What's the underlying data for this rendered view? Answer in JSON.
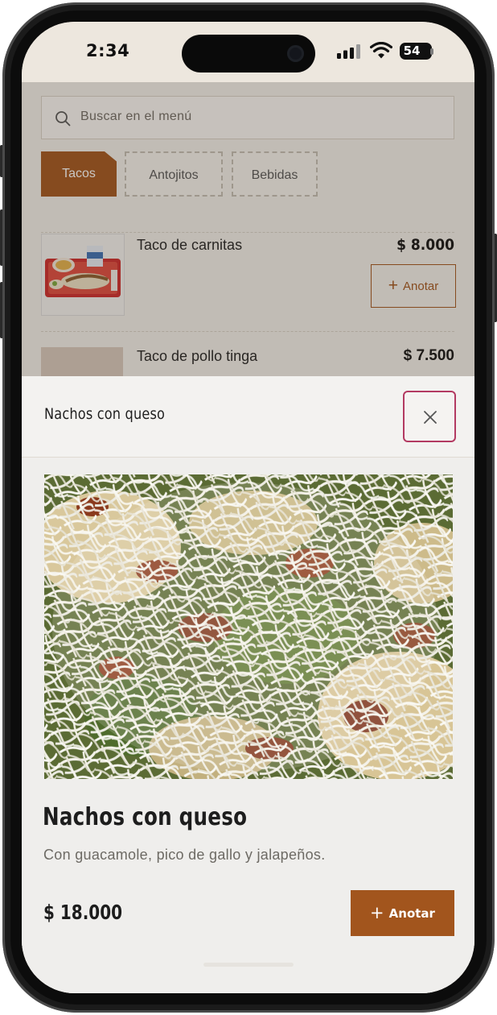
{
  "status_bar": {
    "time": "2:34",
    "battery": "54"
  },
  "menu": {
    "search_placeholder": "Buscar en el menú",
    "tabs": [
      {
        "label": "Tacos",
        "active": true
      },
      {
        "label": "Antojitos",
        "active": false
      },
      {
        "label": "Bebidas",
        "active": false
      }
    ],
    "items": [
      {
        "name": "Taco de carnitas",
        "price": "$ 8.000",
        "action": "Anotar"
      },
      {
        "name": "Taco de pollo tinga",
        "price": "$ 7.500"
      }
    ]
  },
  "sheet": {
    "header_title": "Nachos con queso",
    "product_name": "Nachos con queso",
    "description": "Con guacamole, pico de gallo y jalapeños.",
    "price": "$ 18.000",
    "add_button": "Anotar",
    "close_icon": "close-icon"
  },
  "colors": {
    "accent": "#a2551d",
    "close_border": "#b33a62",
    "background": "#ede7de"
  }
}
